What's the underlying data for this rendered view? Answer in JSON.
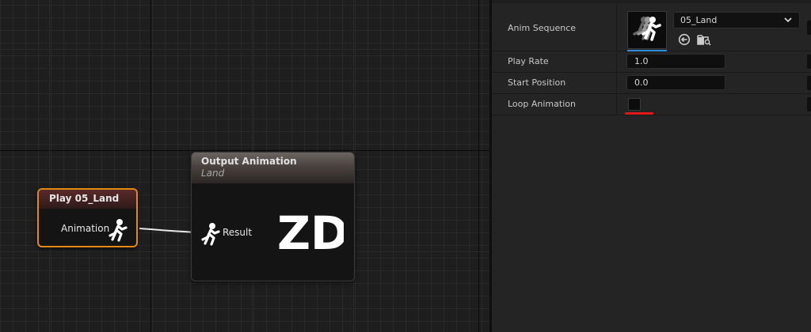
{
  "graph": {
    "play_node": {
      "title": "Play 05_Land",
      "pin_label": "Animation",
      "header_color": "#5a2a2a",
      "selection_color": "#e08a14"
    },
    "output_node": {
      "title": "Output Animation",
      "subtitle": "Land",
      "pin_label": "Result",
      "logo_text": "ZD"
    }
  },
  "details": {
    "anim_sequence": {
      "label": "Anim Sequence",
      "value": "05_Land",
      "icons": [
        "use-selected-icon",
        "browse-asset-icon"
      ]
    },
    "play_rate": {
      "label": "Play Rate",
      "value": "1.0"
    },
    "start_position": {
      "label": "Start Position",
      "value": "0.0"
    },
    "loop_animation": {
      "label": "Loop Animation",
      "checked": false,
      "highlight_color": "#e01818"
    },
    "accent_color": "#2a8fd8"
  }
}
